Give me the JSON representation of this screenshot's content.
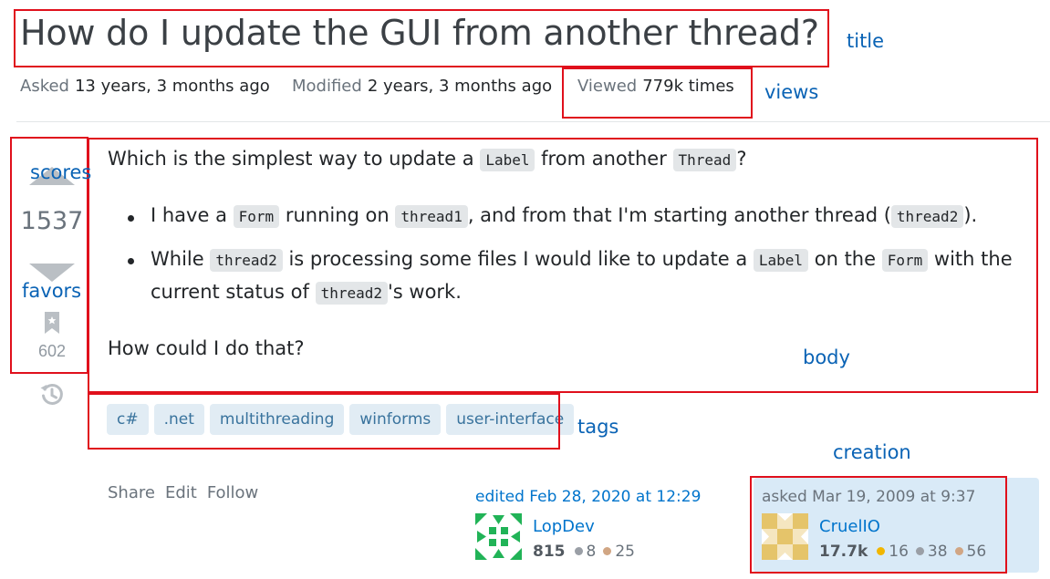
{
  "question": {
    "title": "How do I update the GUI from another thread?",
    "asked_key": "Asked",
    "asked_value": "13 years, 3 months ago",
    "modified_key": "Modified",
    "modified_value": "2 years, 3 months ago",
    "viewed_key": "Viewed",
    "viewed_value": "779k times"
  },
  "votes": {
    "score": "1537",
    "favorites": "602"
  },
  "body": {
    "p1_a": "Which is the simplest way to update a ",
    "p1_code1": "Label",
    "p1_b": " from another ",
    "p1_code2": "Thread",
    "p1_c": "?",
    "li1_a": "I have a ",
    "li1_code1": "Form",
    "li1_b": " running on ",
    "li1_code2": "thread1",
    "li1_c": ", and from that I'm starting another thread (",
    "li1_code3": "thread2",
    "li1_d": ").",
    "li2_a": "While ",
    "li2_code1": "thread2",
    "li2_b": " is processing some files I would like to update a ",
    "li2_code2": "Label",
    "li2_c": " on the ",
    "li2_code3": "Form",
    "li2_d": " with the",
    "li2_e": "current status of ",
    "li2_code4": "thread2",
    "li2_f": "'s work.",
    "p_last": "How could I do that?"
  },
  "tags": [
    "c#",
    ".net",
    "multithreading",
    "winforms",
    "user-interface"
  ],
  "actions": {
    "share": "Share",
    "edit": "Edit",
    "follow": "Follow"
  },
  "editor": {
    "edited_label": "edited Feb 28, 2020 at 12:29",
    "name": "LopDev",
    "reputation": "815",
    "silver": "8",
    "bronze": "25"
  },
  "asker": {
    "asked_label": "asked Mar 19, 2009 at 9:37",
    "name": "CruelIO",
    "reputation": "17.7k",
    "gold": "16",
    "silver": "38",
    "bronze": "56"
  },
  "annotations": {
    "title": "title",
    "views": "views",
    "scores": "scores",
    "favors": "favors",
    "body": "body",
    "tags": "tags",
    "creation": "creation"
  },
  "colors": {
    "annotation_box": "#e0101c",
    "annotation_text": "#0a63b5",
    "link": "#0074cc",
    "tag_bg": "#e1ecf4",
    "tag_text": "#39739d",
    "asker_card_bg": "#d9eaf7",
    "gold_badge": "#f1b600",
    "silver_badge": "#9a9fa6",
    "bronze_badge": "#d1a684"
  }
}
